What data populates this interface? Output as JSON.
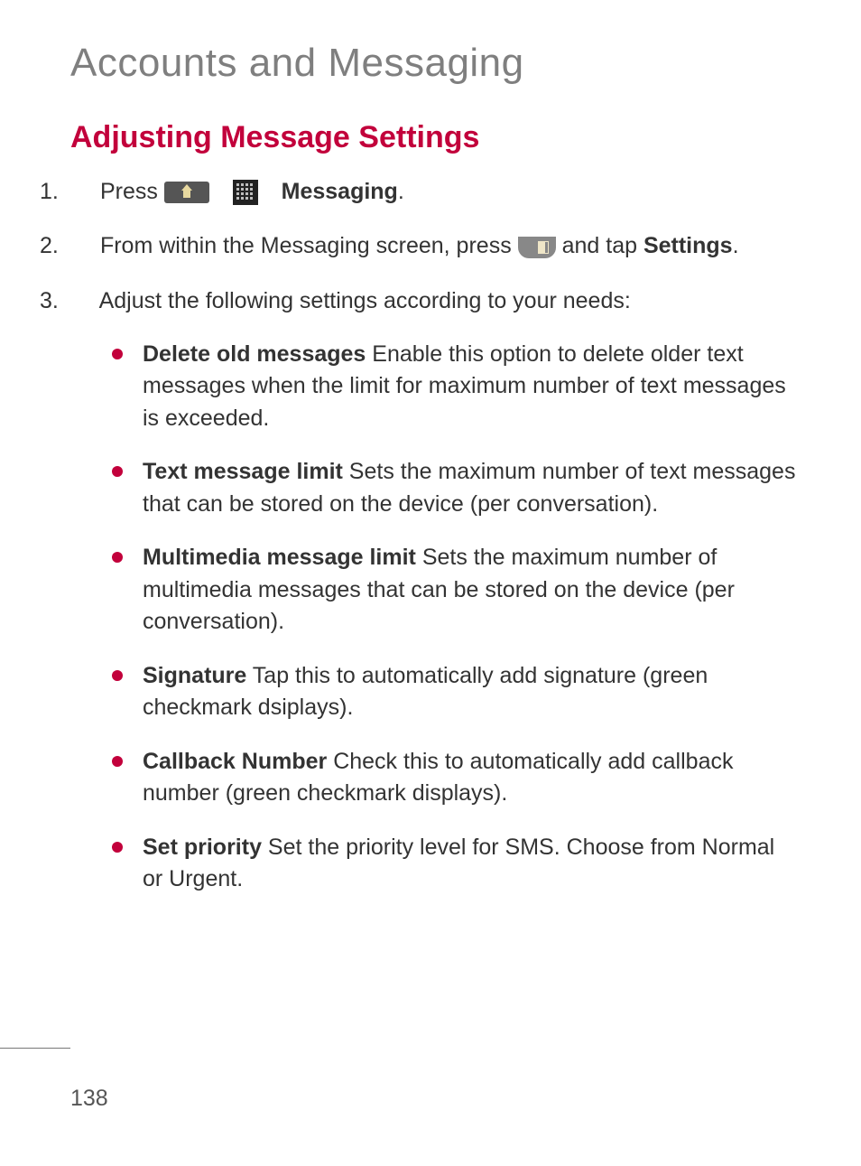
{
  "page_title": "Accounts and Messaging",
  "section_title": "Adjusting Message Settings",
  "steps": {
    "s1": {
      "num": "1.",
      "press": "Press ",
      "caret": " > ",
      "messaging": "Messaging",
      "period": "."
    },
    "s2": {
      "num": "2.",
      "text1": "From within the Messaging screen, press ",
      "text2": " and tap ",
      "bold": "Settings",
      "period": "."
    },
    "s3": {
      "num": "3.",
      "text": "Adjust the following settings according to your needs:"
    }
  },
  "bullets": [
    {
      "bold": "Delete old messages",
      "text": " Enable this option to delete older text messages when the limit for maximum number of text messages is exceeded."
    },
    {
      "bold": "Text message limit",
      "text": " Sets the maximum number of text messages that can be stored on the device (per conversation)."
    },
    {
      "bold": "Multimedia message limit",
      "text": " Sets the maximum number of multimedia messages that can be stored on the device (per conversation)."
    },
    {
      "bold": "Signature",
      "text": " Tap this to automatically add signature (green checkmark dsiplays)."
    },
    {
      "bold": "Callback Number",
      "text": " Check this to automatically add callback number (green checkmark displays)."
    },
    {
      "bold": "Set priority",
      "text": " Set the priority level for SMS. Choose from Normal or Urgent."
    }
  ],
  "page_number": "138"
}
